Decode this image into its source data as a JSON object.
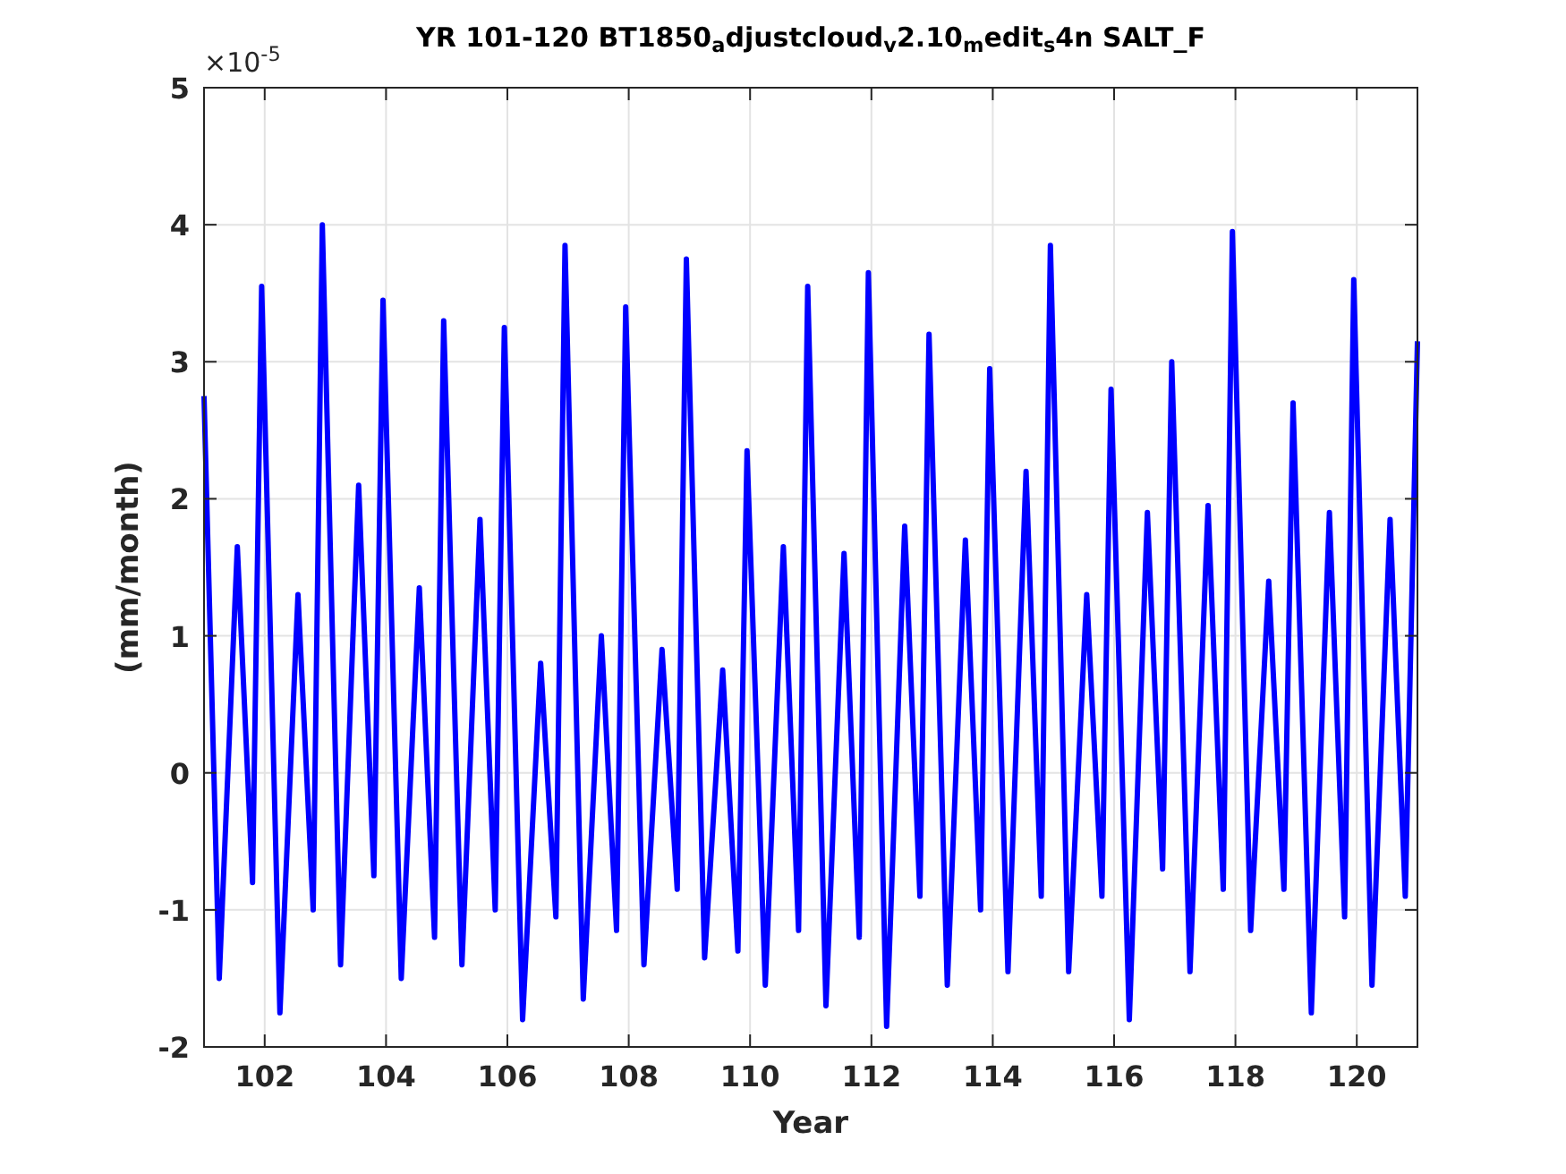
{
  "figure": {
    "axis_multiplier": "×10$^{-5}$",
    "chart_data": {
      "type": "line",
      "title": "YR 101-120 BT1850$_{a}$djustcloud$_{v}$2.10$_{m}$edit$_{s}$4n SALT_F",
      "xlabel": "Year",
      "ylabel": "(mm/month)",
      "grid": true,
      "xlim": [
        101,
        121
      ],
      "ylim": [
        -2,
        5
      ],
      "xticks": [
        {
          "value": 102,
          "label": "102"
        },
        {
          "value": 104,
          "label": "104"
        },
        {
          "value": 106,
          "label": "106"
        },
        {
          "value": 108,
          "label": "108"
        },
        {
          "value": 110,
          "label": "110"
        },
        {
          "value": 112,
          "label": "112"
        },
        {
          "value": 114,
          "label": "114"
        },
        {
          "value": 116,
          "label": "116"
        },
        {
          "value": 118,
          "label": "118"
        },
        {
          "value": 120,
          "label": "120"
        }
      ],
      "yticks": [
        {
          "value": -2,
          "label": "-2"
        },
        {
          "value": -1,
          "label": "-1"
        },
        {
          "value": 0,
          "label": "0"
        },
        {
          "value": 1,
          "label": "1"
        },
        {
          "value": 2,
          "label": "2"
        },
        {
          "value": 3,
          "label": "3"
        },
        {
          "value": 4,
          "label": "4"
        },
        {
          "value": 5,
          "label": "5"
        }
      ],
      "x": [
        101.0,
        101.25,
        101.55,
        101.8,
        101.95,
        102.25,
        102.55,
        102.8,
        102.95,
        103.25,
        103.55,
        103.8,
        103.95,
        104.25,
        104.55,
        104.8,
        104.95,
        105.25,
        105.55,
        105.8,
        105.95,
        106.25,
        106.55,
        106.8,
        106.95,
        107.25,
        107.55,
        107.8,
        107.95,
        108.25,
        108.55,
        108.8,
        108.95,
        109.25,
        109.55,
        109.8,
        109.95,
        110.25,
        110.55,
        110.8,
        110.95,
        111.25,
        111.55,
        111.8,
        111.95,
        112.25,
        112.55,
        112.8,
        112.95,
        113.25,
        113.55,
        113.8,
        113.95,
        114.25,
        114.55,
        114.8,
        114.95,
        115.25,
        115.55,
        115.8,
        115.95,
        116.25,
        116.55,
        116.8,
        116.95,
        117.25,
        117.55,
        117.8,
        117.95,
        118.25,
        118.55,
        118.8,
        118.95,
        119.25,
        119.55,
        119.8,
        119.95,
        120.25,
        120.55,
        120.8,
        121.0
      ],
      "series": [
        {
          "color": "#0000ff",
          "values": [
            2.75,
            -1.5,
            1.65,
            -0.8,
            3.55,
            -1.75,
            1.3,
            -1.0,
            4.0,
            -1.4,
            2.1,
            -0.75,
            3.45,
            -1.5,
            1.35,
            -1.2,
            3.3,
            -1.4,
            1.85,
            -1.0,
            3.25,
            -1.8,
            0.8,
            -1.05,
            3.85,
            -1.65,
            1.0,
            -1.15,
            3.4,
            -1.4,
            0.9,
            -0.85,
            3.75,
            -1.35,
            0.75,
            -1.3,
            2.35,
            -1.55,
            1.65,
            -1.15,
            3.55,
            -1.7,
            1.6,
            -1.2,
            3.65,
            -1.85,
            1.8,
            -0.9,
            3.2,
            -1.55,
            1.7,
            -1.0,
            2.95,
            -1.45,
            2.2,
            -0.9,
            3.85,
            -1.45,
            1.3,
            -0.9,
            2.8,
            -1.8,
            1.9,
            -0.7,
            3.0,
            -1.45,
            1.95,
            -0.85,
            3.95,
            -1.15,
            1.4,
            -0.85,
            2.7,
            -1.75,
            1.9,
            -1.05,
            3.6,
            -1.55,
            1.85,
            -0.9,
            3.15
          ]
        }
      ]
    }
  }
}
